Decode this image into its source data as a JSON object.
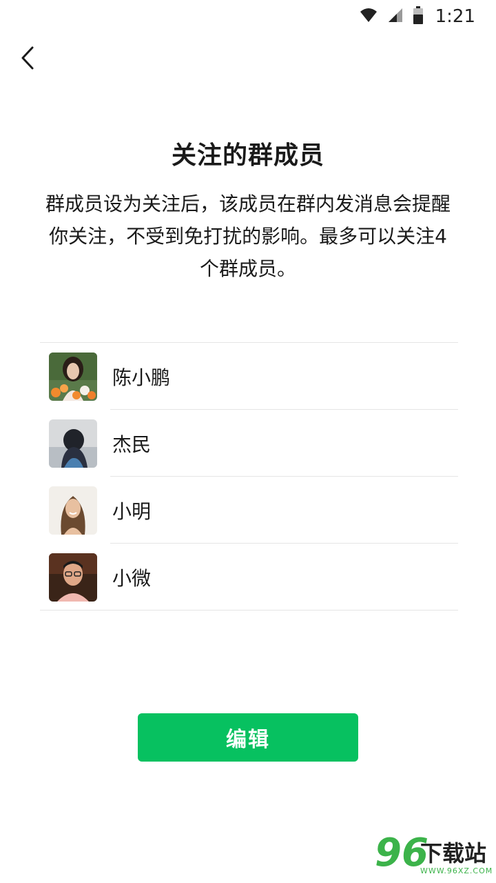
{
  "status_bar": {
    "time": "1:21",
    "icons": [
      "wifi-icon",
      "signal-icon",
      "battery-icon"
    ]
  },
  "nav": {
    "back_icon": "chevron-left-icon"
  },
  "page": {
    "title": "关注的群成员",
    "description": "群成员设为关注后，该成员在群内发消息会提醒你关注，不受到免打扰的影响。最多可以关注4个群成员。"
  },
  "members": [
    {
      "name": "陈小鹏",
      "avatar": "avatar-photo-woman-flowers"
    },
    {
      "name": "杰民",
      "avatar": "avatar-photo-back-of-head"
    },
    {
      "name": "小明",
      "avatar": "avatar-photo-smiling-woman"
    },
    {
      "name": "小微",
      "avatar": "avatar-photo-man-glasses"
    }
  ],
  "actions": {
    "edit_label": "编辑"
  },
  "watermark": {
    "digits": "96",
    "text": "下载站",
    "url": "WWW.96XZ.COM"
  },
  "colors": {
    "primary_green": "#07c160",
    "divider": "#e5e5e5",
    "watermark_green": "#3cb34a"
  }
}
